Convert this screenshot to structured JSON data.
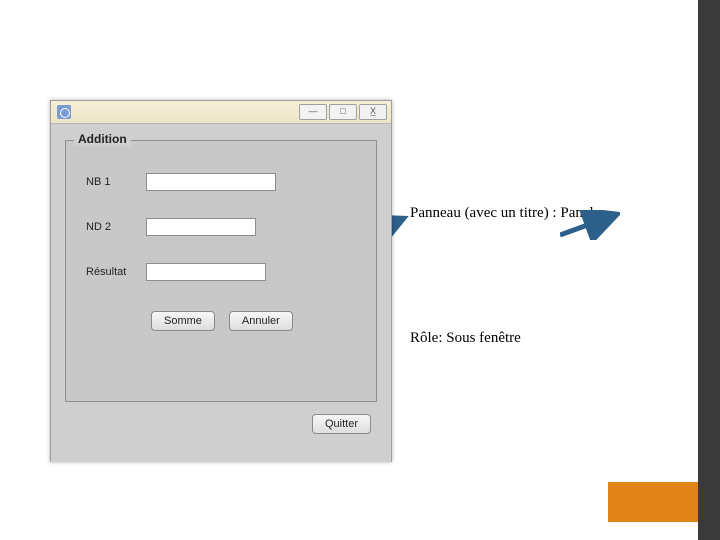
{
  "window": {
    "controls": {
      "min": "—",
      "max": "□",
      "close": "X̲"
    },
    "panel": {
      "title": "Addition",
      "rows": {
        "nb1": {
          "label": "NB 1",
          "value": ""
        },
        "nd2": {
          "label": "ND 2",
          "value": ""
        },
        "res": {
          "label": "Résultat",
          "value": ""
        }
      },
      "buttons": {
        "sum": "Somme",
        "cancel": "Annuler"
      }
    },
    "quit": "Quitter"
  },
  "annotations": {
    "panel_label": "Panneau (avec un titre) :  Panel",
    "role_label": "Rôle: Sous fenêtre"
  }
}
